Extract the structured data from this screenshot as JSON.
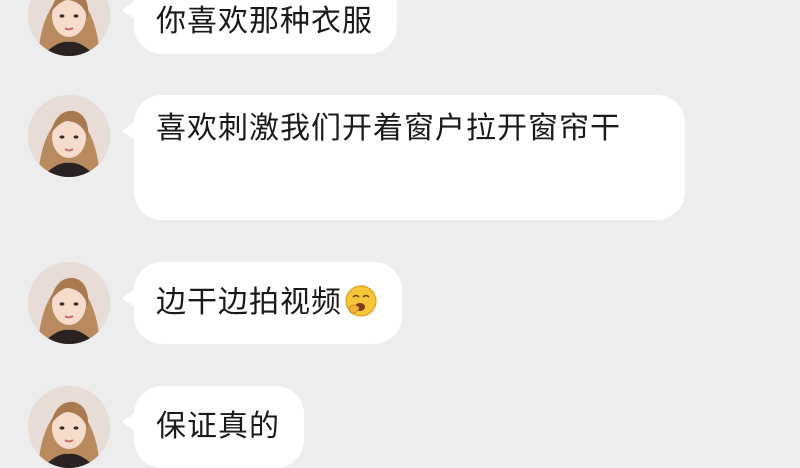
{
  "messages": [
    {
      "text": "你喜欢那种衣服"
    },
    {
      "text": "喜欢刺激我们开着窗户拉开窗帘干"
    },
    {
      "text": "边干边拍视频",
      "emoji": "yawning-face-emoji"
    },
    {
      "text": "保证真的"
    }
  ],
  "colors": {
    "background": "#ededed",
    "bubble": "#ffffff",
    "text": "#1a1a1a",
    "emoji": "#f5c53a"
  }
}
